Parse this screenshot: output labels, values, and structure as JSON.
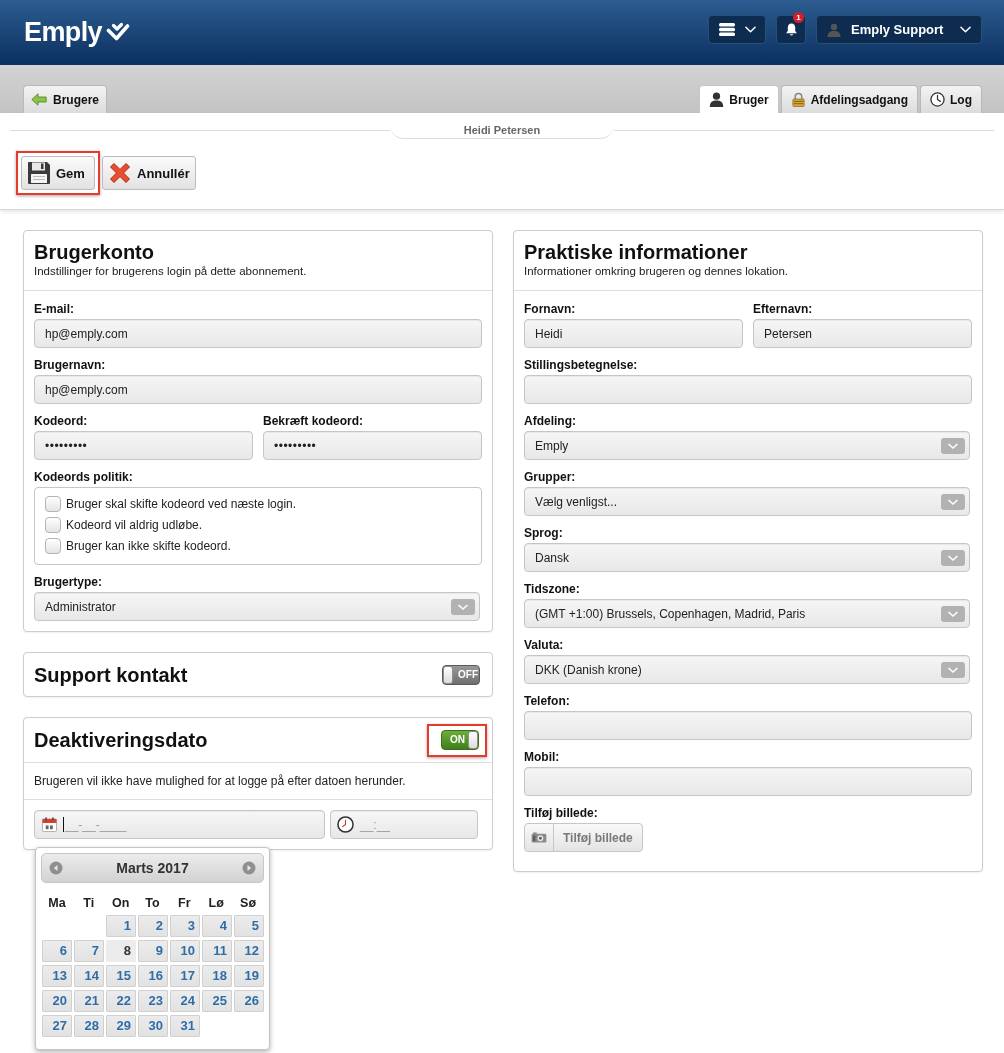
{
  "header": {
    "logo": "Emply",
    "notifications": {
      "count": "1"
    },
    "user_menu": {
      "name": "Emply Support"
    }
  },
  "navigation": {
    "back_tab": {
      "label": "Brugere"
    },
    "tabs": [
      {
        "label": "Bruger",
        "selected": true
      },
      {
        "label": "Afdelingsadgang",
        "selected": false
      },
      {
        "label": "Log",
        "selected": false
      }
    ]
  },
  "record_title": "Heidi Petersen",
  "actions": [
    {
      "label": "Gem",
      "highlighted": true
    },
    {
      "label": "Annullér",
      "highlighted": false
    }
  ],
  "account": {
    "title": "Brugerkonto",
    "subtitle": "Indstillinger for brugerens login på dette abonnement.",
    "rows": [
      [
        {
          "kind": "text",
          "label": "E-mail:",
          "value": "hp@emply.com"
        }
      ],
      [
        {
          "kind": "text",
          "label": "Brugernavn:",
          "value": "hp@emply.com"
        }
      ],
      [
        {
          "kind": "password",
          "label": "Kodeord:",
          "value": "•••••••••"
        },
        {
          "kind": "password",
          "label": "Bekræft kodeord:",
          "value": "•••••••••"
        }
      ],
      [
        {
          "kind": "checkboxes",
          "label": "Kodeords politik:",
          "options": [
            {
              "label": "Bruger skal skifte kodeord ved næste login.",
              "checked": false
            },
            {
              "label": "Kodeord vil aldrig udløbe.",
              "checked": false
            },
            {
              "label": "Bruger kan ikke skifte kodeord.",
              "checked": false
            }
          ]
        }
      ],
      [
        {
          "kind": "select",
          "label": "Brugertype:",
          "value": "Administrator"
        }
      ]
    ]
  },
  "support_contact": {
    "title": "Support kontakt",
    "toggle": {
      "on": false,
      "label": "OFF"
    }
  },
  "deactivation": {
    "title": "Deaktiveringsdato",
    "toggle": {
      "on": true,
      "label": "ON",
      "highlighted": true
    },
    "description": "Brugeren vil ikke have mulighed for at logge på efter datoen herunder.",
    "date_field": {
      "placeholder": "__-__-____",
      "focused": true
    },
    "time_field": {
      "placeholder": "__:__"
    },
    "datepicker": {
      "title": "Marts 2017",
      "weekdays": [
        "Ma",
        "Ti",
        "On",
        "To",
        "Fr",
        "Lø",
        "Sø"
      ],
      "weeks": [
        [
          {
            "kind": "blank"
          },
          {
            "kind": "blank"
          },
          {
            "kind": "day",
            "label": "1",
            "today": false
          },
          {
            "kind": "day",
            "label": "2",
            "today": false
          },
          {
            "kind": "day",
            "label": "3",
            "today": false
          },
          {
            "kind": "day",
            "label": "4",
            "today": false
          },
          {
            "kind": "day",
            "label": "5",
            "today": false
          }
        ],
        [
          {
            "kind": "day",
            "label": "6",
            "today": false
          },
          {
            "kind": "day",
            "label": "7",
            "today": false
          },
          {
            "kind": "day",
            "label": "8",
            "today": true
          },
          {
            "kind": "day",
            "label": "9",
            "today": false
          },
          {
            "kind": "day",
            "label": "10",
            "today": false
          },
          {
            "kind": "day",
            "label": "11",
            "today": false
          },
          {
            "kind": "day",
            "label": "12",
            "today": false
          }
        ],
        [
          {
            "kind": "day",
            "label": "13",
            "today": false
          },
          {
            "kind": "day",
            "label": "14",
            "today": false
          },
          {
            "kind": "day",
            "label": "15",
            "today": false
          },
          {
            "kind": "day",
            "label": "16",
            "today": false
          },
          {
            "kind": "day",
            "label": "17",
            "today": false
          },
          {
            "kind": "day",
            "label": "18",
            "today": false
          },
          {
            "kind": "day",
            "label": "19",
            "today": false
          }
        ],
        [
          {
            "kind": "day",
            "label": "20",
            "today": false
          },
          {
            "kind": "day",
            "label": "21",
            "today": false
          },
          {
            "kind": "day",
            "label": "22",
            "today": false
          },
          {
            "kind": "day",
            "label": "23",
            "today": false
          },
          {
            "kind": "day",
            "label": "24",
            "today": false
          },
          {
            "kind": "day",
            "label": "25",
            "today": false
          },
          {
            "kind": "day",
            "label": "26",
            "today": false
          }
        ],
        [
          {
            "kind": "day",
            "label": "27",
            "today": false
          },
          {
            "kind": "day",
            "label": "28",
            "today": false
          },
          {
            "kind": "day",
            "label": "29",
            "today": false
          },
          {
            "kind": "day",
            "label": "30",
            "today": false
          },
          {
            "kind": "day",
            "label": "31",
            "today": false
          }
        ]
      ]
    }
  },
  "practical": {
    "title": "Praktiske informationer",
    "subtitle": "Informationer omkring brugeren og dennes lokation.",
    "rows": [
      [
        {
          "kind": "text",
          "label": "Fornavn:",
          "value": "Heidi"
        },
        {
          "kind": "text",
          "label": "Efternavn:",
          "value": "Petersen"
        }
      ],
      [
        {
          "kind": "text",
          "label": "Stillingsbetegnelse:"
        }
      ],
      [
        {
          "kind": "select",
          "label": "Afdeling:",
          "value": "Emply"
        }
      ],
      [
        {
          "kind": "select",
          "label": "Grupper:",
          "value": "Vælg venligst..."
        }
      ],
      [
        {
          "kind": "select",
          "label": "Sprog:",
          "value": "Dansk"
        }
      ],
      [
        {
          "kind": "select",
          "label": "Tidszone:",
          "value": "(GMT +1:00) Brussels, Copenhagen, Madrid, Paris"
        }
      ],
      [
        {
          "kind": "select",
          "label": "Valuta:",
          "value": "DKK (Danish krone)"
        }
      ],
      [
        {
          "kind": "text",
          "label": "Telefon:"
        }
      ],
      [
        {
          "kind": "text",
          "label": "Mobil:"
        }
      ],
      [
        {
          "kind": "upload",
          "label": "Tilføj billede:",
          "button": "Tilføj billede"
        }
      ]
    ]
  }
}
